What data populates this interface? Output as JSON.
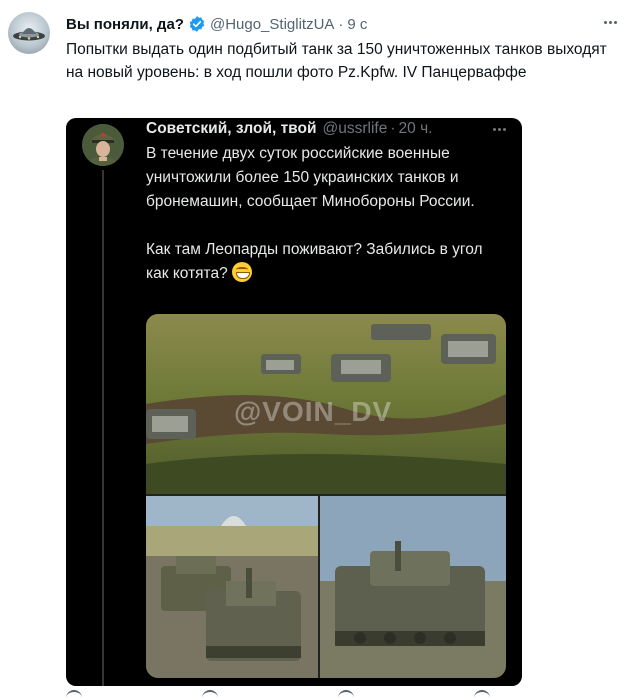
{
  "tweet": {
    "author_name": "Вы поняли, да?",
    "handle": "@Hugo_StiglitzUA",
    "separator": "·",
    "time": "9 с",
    "text": "Попытки выдать один подбитый танк за 150 уничтоженных танков выходят на новый уровень: в ход пошли фото Pz.Kpfw. IV Панцерваффе",
    "verified_color": "#1d9bf0"
  },
  "quoted_tweet": {
    "author_name": "Советский, злой, твой",
    "handle": "@ussrlife",
    "separator": "·",
    "time": "20 ч.",
    "paragraph_1": "В течение двух суток российские военные уничтожили более 150 украинских танков и бронемашин, сообщает Минобороны России.",
    "paragraph_2": "Как там Леопарды поживают? Забились в угол как котята?",
    "emoji": "grinning-face-emoji",
    "media_watermark": "@VOIN_DV"
  }
}
